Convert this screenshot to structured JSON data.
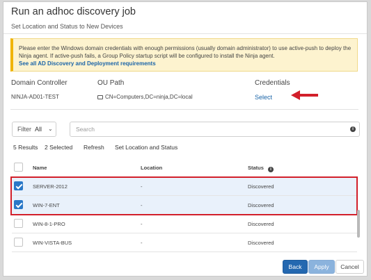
{
  "dialog": {
    "title": "Run an adhoc discovery job",
    "subtitle": "Set Location and Status to New Devices"
  },
  "alert": {
    "message": "Please enter the Windows domain credentials with enough permissions (usually domain administrator) to use active-push to deploy the Ninja agent. If active-push fails, a Group Policy startup script will be configured to install the Ninja agent.",
    "link_text": "See all AD Discovery and Deployment requirements",
    "colors": {
      "background": "#fdf3cf",
      "accent": "#f0b400"
    }
  },
  "info": {
    "domain_controller_label": "Domain Controller",
    "domain_controller_value": "NINJA-AD01-TEST",
    "ou_path_label": "OU Path",
    "ou_path_value": "CN=Computers,DC=ninja,DC=local",
    "ou_path_icon": "folder-icon",
    "credentials_label": "Credentials",
    "credentials_link": "Select"
  },
  "filter": {
    "label": "Filter",
    "value": "All",
    "search_placeholder": "Search"
  },
  "toolbar": {
    "results": "5 Results",
    "selected": "2 Selected",
    "refresh": "Refresh",
    "set_location": "Set Location and Status"
  },
  "table": {
    "columns": [
      "Name",
      "Location",
      "Status"
    ],
    "rows": [
      {
        "name": "SERVER-2012",
        "location": "-",
        "status": "Discovered",
        "checked": true
      },
      {
        "name": "WIN-7-ENT",
        "location": "-",
        "status": "Discovered",
        "checked": true
      },
      {
        "name": "WIN-8-1-PRO",
        "location": "-",
        "status": "Discovered",
        "checked": false
      },
      {
        "name": "WIN-VISTA-BUS",
        "location": "-",
        "status": "Discovered",
        "checked": false
      }
    ]
  },
  "buttons": {
    "back": "Back",
    "apply": "Apply",
    "cancel": "Cancel"
  },
  "colors": {
    "accent": "#2468b0",
    "link": "#1a64a8",
    "highlight_box": "#d21f2a",
    "arrow": "#d21f2a"
  }
}
